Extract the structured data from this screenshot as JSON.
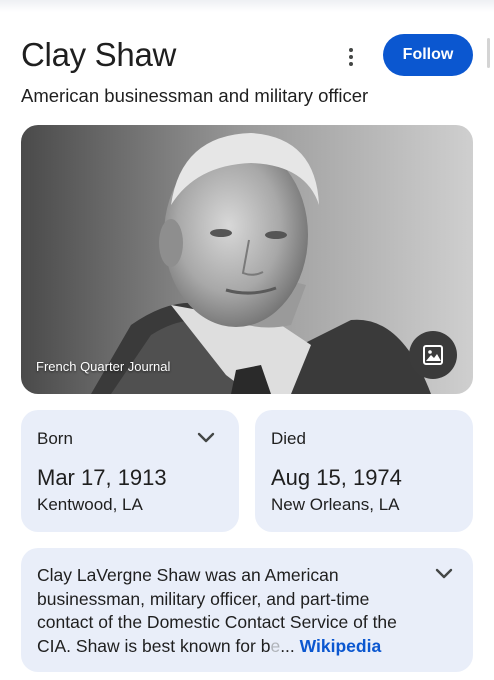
{
  "header": {
    "title": "Clay Shaw",
    "subtitle": "American businessman and military officer",
    "follow_label": "Follow"
  },
  "photo": {
    "caption": "French Quarter Journal"
  },
  "born": {
    "label": "Born",
    "date": "Mar 17, 1913",
    "place": "Kentwood, LA"
  },
  "died": {
    "label": "Died",
    "date": "Aug 15, 1974",
    "place": "New Orleans, LA"
  },
  "description": {
    "text": "Clay LaVergne Shaw was an American businessman, military officer, and part-time contact of the Domestic Contact Service of the CIA. Shaw is best known for b",
    "faded": "e",
    "ellipsis": "...",
    "source_link": "Wikipedia"
  },
  "colors": {
    "accent": "#0b57d0",
    "card_bg": "#e9eef9"
  },
  "icons": [
    "more-vert-icon",
    "image-icon",
    "chevron-down-icon"
  ]
}
